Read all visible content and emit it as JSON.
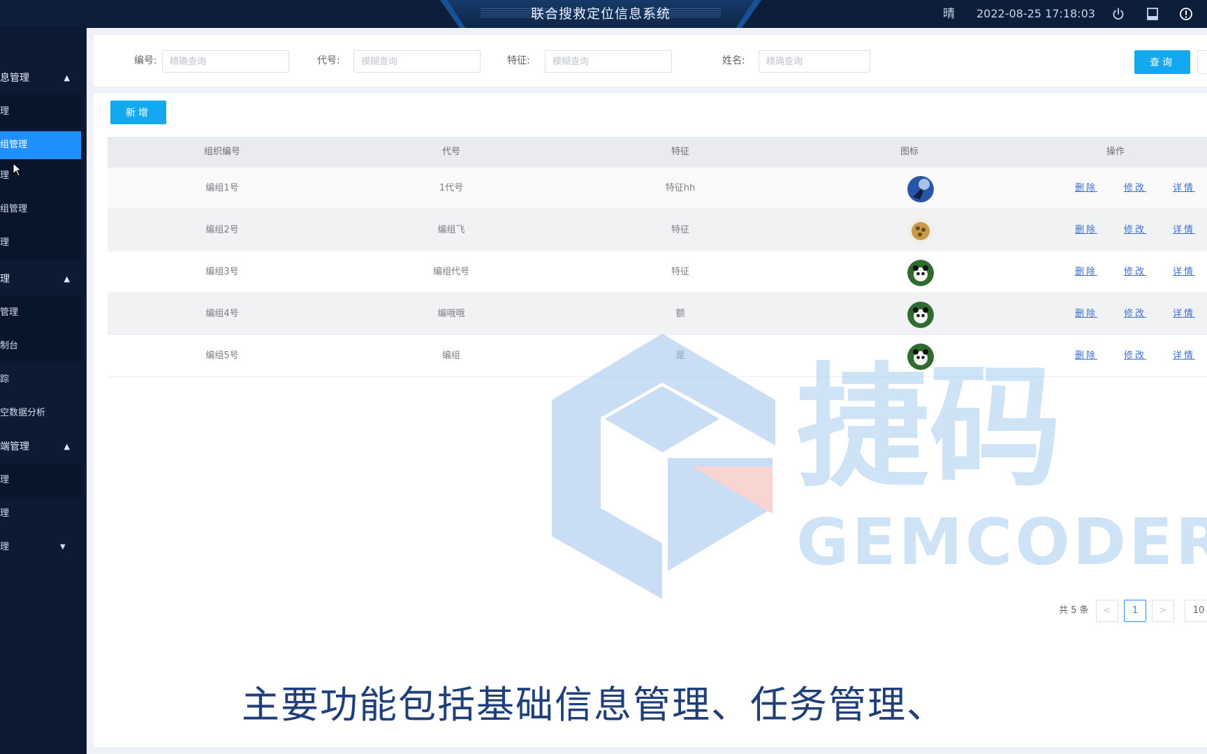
{
  "header": {
    "title": "联合搜救定位信息系统",
    "weather": "晴",
    "datetime": "2022-08-25 17:18:03",
    "icons": [
      "power-icon",
      "book-icon",
      "info-icon"
    ]
  },
  "sidebar": {
    "groups": [
      {
        "label": "息管理",
        "caret": "▲"
      },
      {
        "label": "理",
        "caret": "▲"
      },
      {
        "label": "端管理",
        "caret": "▲"
      }
    ],
    "items": [
      {
        "label": "理"
      },
      {
        "label": "组管理"
      },
      {
        "label": "理"
      },
      {
        "label": "组管理"
      },
      {
        "label": "理"
      },
      {
        "label": "管理"
      },
      {
        "label": "制台"
      },
      {
        "label": "踪"
      },
      {
        "label": "空数据分析"
      },
      {
        "label": "理"
      },
      {
        "label": "理"
      },
      {
        "label": "理",
        "caret": "▼"
      }
    ]
  },
  "filters": {
    "fields": [
      {
        "label": "编号:",
        "placeholder": "精确查询"
      },
      {
        "label": "代号:",
        "placeholder": "模糊查询"
      },
      {
        "label": "特征:",
        "placeholder": "模糊查询"
      },
      {
        "label": "姓名:",
        "placeholder": "精确查询"
      }
    ],
    "query_label": "查询"
  },
  "toolbar": {
    "add_label": "新增"
  },
  "table": {
    "columns": [
      "组织编号",
      "代号",
      "特征",
      "图标",
      "操作"
    ],
    "rows": [
      {
        "id": "编组1号",
        "code": "1代号",
        "feature": "特征hh",
        "icon": "blue-sky-avatar"
      },
      {
        "id": "编组2号",
        "code": "编组飞",
        "feature": "特征",
        "icon": "gold-ball-avatar"
      },
      {
        "id": "编组3号",
        "code": "编组代号",
        "feature": "特征",
        "icon": "panda-avatar"
      },
      {
        "id": "编组4号",
        "code": "编哦哦",
        "feature": "额",
        "icon": "panda-avatar"
      },
      {
        "id": "编组5号",
        "code": "编组",
        "feature": "是",
        "icon": "panda-avatar"
      }
    ],
    "actions": {
      "delete": "删除",
      "edit": "修改",
      "detail": "详情"
    }
  },
  "pagination": {
    "total": "共 5 条",
    "current": "1",
    "page_size": "10",
    "prev": "<",
    "next": ">"
  },
  "watermark": {
    "brand_cn": "捷码",
    "brand_en": "GEMCODER"
  },
  "caption": "主要功能包括基础信息管理、任务管理、",
  "colors": {
    "primary": "#13a9f1",
    "sidebar_bg": "#0c1a33",
    "active_item": "#1e90ff",
    "link": "#3a6fd1"
  }
}
